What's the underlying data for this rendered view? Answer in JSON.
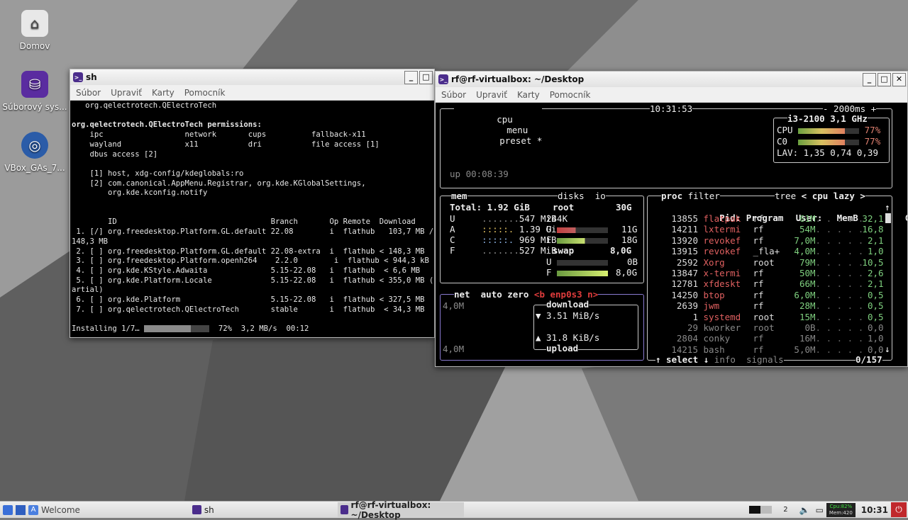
{
  "desktop": {
    "icons": [
      {
        "label": "Domov"
      },
      {
        "label": "Súborový sys..."
      },
      {
        "label": "VBox_GAs_7..."
      }
    ]
  },
  "win1": {
    "title": "sh",
    "menu": [
      "Súbor",
      "Upraviť",
      "Karty",
      "Pomocník"
    ],
    "lines": [
      "   org.qelectrotech.QElectroTech",
      "",
      "org.qelectrotech.QElectroTech permissions:",
      "    ipc                  network       cups          fallback-x11",
      "    wayland              x11           dri           file access [1]",
      "    dbus access [2]",
      "",
      "    [1] host, xdg-config/kdeglobals:ro",
      "    [2] com.canonical.AppMenu.Registrar, org.kde.KGlobalSettings,",
      "        org.kde.kconfig.notify",
      "",
      "",
      "        ID                                  Branch       Op Remote  Download",
      " 1. [/] org.freedesktop.Platform.GL.default 22.08        i  flathub   103,7 MB /",
      "148,3 MB",
      " 2. [ ] org.freedesktop.Platform.GL.default 22.08-extra  i  flathub < 148,3 MB",
      " 3. [ ] org.freedesktop.Platform.openh264    2.2.0        i  flathub < 944,3 kB",
      " 4. [ ] org.kde.KStyle.Adwaita              5.15-22.08   i  flathub  < 6,6 MB",
      " 5. [ ] org.kde.Platform.Locale             5.15-22.08   i  flathub < 355,0 MB (",
      "artial)",
      " 6. [ ] org.kde.Platform                    5.15-22.08   i  flathub < 327,5 MB",
      " 7. [ ] org.qelectrotech.QElectroTech       stable       i  flathub  < 34,3 MB",
      ""
    ],
    "status_prefix": "Installing 1/7…",
    "status_suffix": "  72%  3,2 MB/s  00:12",
    "progress": 0.72
  },
  "win2": {
    "title": "rf@rf-virtualbox: ~/Desktop",
    "menu": [
      "Súbor",
      "Upraviť",
      "Karty",
      "Pomocník"
    ],
    "btop": {
      "cpu_tab": "cpu",
      "menu_tab": "menu",
      "preset_tab": "preset *",
      "clock": "10:31:53",
      "interval": "- 2000ms +",
      "uptime": "up 00:08:39",
      "cpu_model": "i3-2100",
      "cpu_freq": "3,1 GHz",
      "cpu_label": "CPU",
      "cpu_pct": "77%",
      "c0_label": "C0",
      "c0_pct": "77%",
      "lav": "LAV: 1,35 0,74 0,39",
      "cpu_usage": 0.77,
      "mem_title": "mem",
      "mem_total": "Total: 1.92 GiB",
      "mem_rows": [
        {
          "k": "U",
          "v": "547 MiB"
        },
        {
          "k": "A",
          "v": "1.39 Gi"
        },
        {
          "k": "C",
          "v": "969 MiB"
        },
        {
          "k": "F",
          "v": "527 MiB"
        }
      ],
      "disks_title": "disks",
      "io_title": "io",
      "root_label": "root",
      "root_size": "30G",
      "root_io": "244K",
      "root_u": "11G",
      "root_f": "18G",
      "root_used": 0.37,
      "swap_label": "swap",
      "swap_size": "8,0G",
      "swap_u": "0B",
      "swap_f": "8,0G",
      "net_title": "net",
      "net_auto": "auto",
      "net_zero": "zero",
      "net_iface": "<b enp0s3 n>",
      "net_scale_top": "4,0M",
      "net_scale_bottom": "4,0M",
      "download_label": "download",
      "download_val": "▼ 3.51 MiB/s",
      "upload_val": "▲ 31.8 KiB/s",
      "upload_label": "upload",
      "proc_title": "proc",
      "proc_filter": "filter",
      "proc_tree": "tree",
      "proc_sort": "< cpu lazy >",
      "proc_headers": [
        "Pid:",
        "Program",
        "User:",
        "MemB",
        "Cpu%"
      ],
      "procs": [
        {
          "pid": "13855",
          "prog": "flatpak",
          "user": "rf",
          "mem": "61M",
          "cpu": "32,1"
        },
        {
          "pid": "14211",
          "prog": "lxtermi",
          "user": "rf",
          "mem": "54M",
          "cpu": "16,8"
        },
        {
          "pid": "13920",
          "prog": "revokef",
          "user": "rf",
          "mem": "7,0M",
          "cpu": "2,1"
        },
        {
          "pid": "13915",
          "prog": "revokef",
          "user": "_fla+",
          "mem": "4,0M",
          "cpu": "1,0"
        },
        {
          "pid": "2592",
          "prog": "Xorg",
          "user": "root",
          "mem": "79M",
          "cpu": "10,5"
        },
        {
          "pid": "13847",
          "prog": "x-termi",
          "user": "rf",
          "mem": "50M",
          "cpu": "2,6"
        },
        {
          "pid": "12781",
          "prog": "xfdeskt",
          "user": "rf",
          "mem": "66M",
          "cpu": "2,1"
        },
        {
          "pid": "14250",
          "prog": "btop",
          "user": "rf",
          "mem": "6,0M",
          "cpu": "0,5"
        },
        {
          "pid": "2639",
          "prog": "jwm",
          "user": "rf",
          "mem": "28M",
          "cpu": "0,5"
        },
        {
          "pid": "1",
          "prog": "systemd",
          "user": "root",
          "mem": "15M",
          "cpu": "0,5"
        },
        {
          "pid": "29",
          "prog": "kworker",
          "user": "root",
          "mem": "0B",
          "cpu": "0,0"
        },
        {
          "pid": "2804",
          "prog": "conky",
          "user": "rf",
          "mem": "16M",
          "cpu": "1,0"
        },
        {
          "pid": "14215",
          "prog": "bash",
          "user": "rf",
          "mem": "5,0M",
          "cpu": "0,0"
        }
      ],
      "footer_select": "↑ select ↓",
      "footer_info": "info",
      "footer_signals": "signals",
      "footer_count": "0/157"
    }
  },
  "taskbar": {
    "start_label": "Welcome",
    "tasks": [
      "sh",
      "rf@rf-virtualbox: ~/Desktop"
    ],
    "workspace": "2",
    "cpu_mon": "Cpu:82%",
    "mem_mon": "Mem:420",
    "clock": "10:31"
  }
}
